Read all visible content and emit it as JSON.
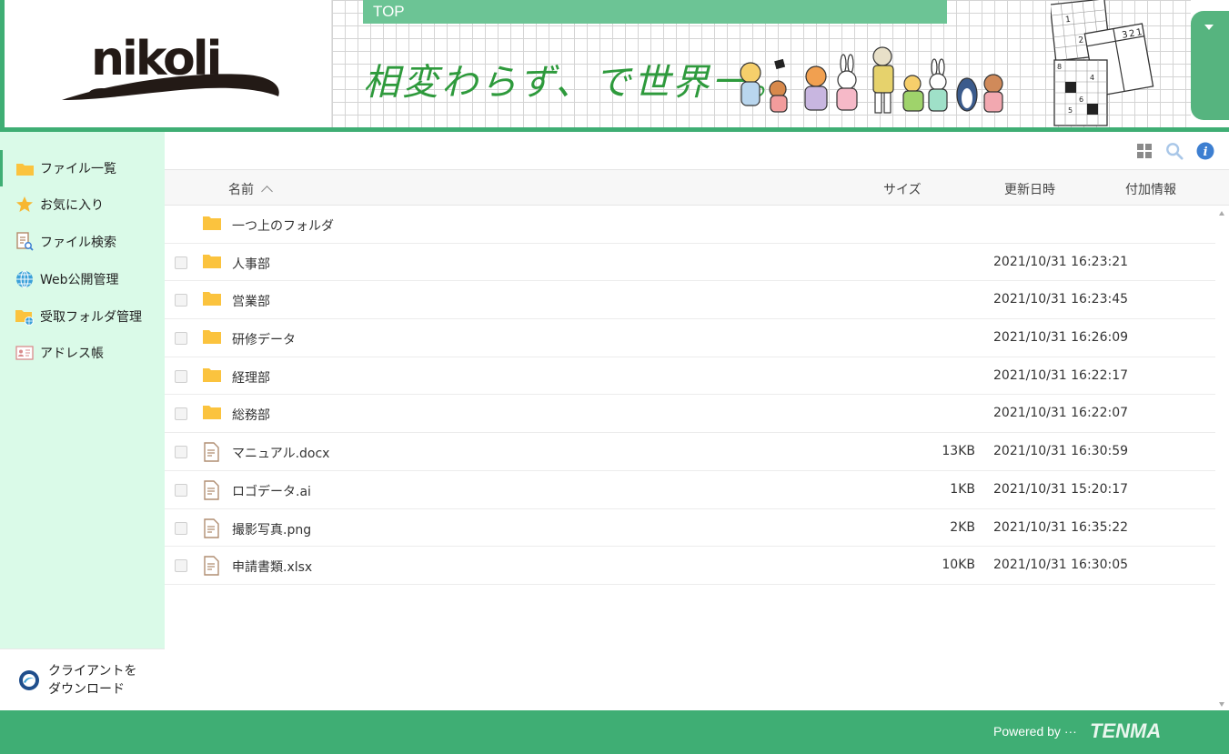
{
  "header": {
    "logo_text": "nikoli",
    "top_tab_label": "TOP",
    "slogan": "相変わらず、で世界一。",
    "puzzle_digits": [
      "1",
      "2",
      "3",
      "2",
      "1",
      "8",
      "4",
      "5",
      "6"
    ]
  },
  "sidebar": {
    "items": [
      {
        "label": "ファイル一覧",
        "icon": "folder-icon",
        "active": true
      },
      {
        "label": "お気に入り",
        "icon": "star-icon",
        "active": false
      },
      {
        "label": "ファイル検索",
        "icon": "file-search-icon",
        "active": false
      },
      {
        "label": "Web公開管理",
        "icon": "globe-icon",
        "active": false
      },
      {
        "label": "受取フォルダ管理",
        "icon": "receive-folder-icon",
        "active": false
      },
      {
        "label": "アドレス帳",
        "icon": "address-book-icon",
        "active": false
      }
    ],
    "download_line1": "クライアントを",
    "download_line2": "ダウンロード"
  },
  "table": {
    "headers": {
      "name": "名前",
      "size": "サイズ",
      "date": "更新日時",
      "info": "付加情報"
    },
    "parent_folder": "一つ上のフォルダ",
    "rows": [
      {
        "type": "folder",
        "name": "人事部",
        "size": "",
        "date": "2021/10/31 16:23:21"
      },
      {
        "type": "folder",
        "name": "営業部",
        "size": "",
        "date": "2021/10/31 16:23:45"
      },
      {
        "type": "folder",
        "name": "研修データ",
        "size": "",
        "date": "2021/10/31 16:26:09"
      },
      {
        "type": "folder",
        "name": "経理部",
        "size": "",
        "date": "2021/10/31 16:22:17"
      },
      {
        "type": "folder",
        "name": "総務部",
        "size": "",
        "date": "2021/10/31 16:22:07"
      },
      {
        "type": "file",
        "name": "マニュアル.docx",
        "size": "13KB",
        "date": "2021/10/31 16:30:59"
      },
      {
        "type": "file",
        "name": "ロゴデータ.ai",
        "size": "1KB",
        "date": "2021/10/31 15:20:17"
      },
      {
        "type": "file",
        "name": "撮影写真.png",
        "size": "2KB",
        "date": "2021/10/31 16:35:22"
      },
      {
        "type": "file",
        "name": "申請書類.xlsx",
        "size": "10KB",
        "date": "2021/10/31 16:30:05"
      }
    ]
  },
  "footer": {
    "powered_by": "Powered by ···",
    "brand": "TENMA"
  },
  "colors": {
    "accent": "#3fae74",
    "sidebar_bg": "#dafae8",
    "folder": "#fbc33e",
    "info": "#3d7fd1"
  }
}
